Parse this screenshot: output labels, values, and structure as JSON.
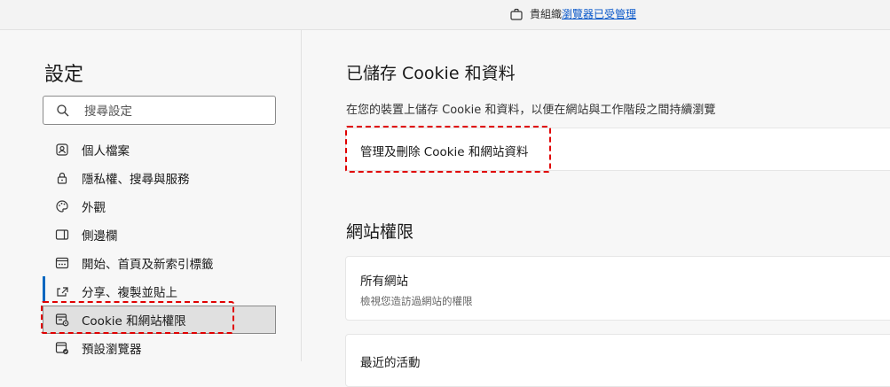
{
  "banner": {
    "prefix": "貴組織",
    "link": "瀏覽器已受管理"
  },
  "sidebar": {
    "title": "設定",
    "search_placeholder": "搜尋設定",
    "items": [
      {
        "label": "個人檔案",
        "icon": "profile-icon"
      },
      {
        "label": "隱私權、搜尋與服務",
        "icon": "lock-icon"
      },
      {
        "label": "外觀",
        "icon": "palette-icon"
      },
      {
        "label": "側邊欄",
        "icon": "sidebar-icon"
      },
      {
        "label": "開始、首頁及新索引標籤",
        "icon": "new-tab-icon"
      },
      {
        "label": "分享、複製並貼上",
        "icon": "share-icon"
      },
      {
        "label": "Cookie 和網站權限",
        "icon": "site-permissions-icon",
        "active": true
      },
      {
        "label": "預設瀏覽器",
        "icon": "default-browser-icon"
      }
    ]
  },
  "main": {
    "cookies": {
      "heading": "已儲存 Cookie 和資料",
      "description": "在您的裝置上儲存 Cookie 和資料，以便在網站與工作階段之間持續瀏覽",
      "manage_label": "管理及刪除 Cookie 和網站資料"
    },
    "permissions": {
      "heading": "網站權限",
      "all_sites_title": "所有網站",
      "all_sites_sub": "檢視您造訪過網站的權限",
      "recent_title": "最近的活動"
    }
  },
  "colors": {
    "accent": "#0067c0",
    "highlight_dash": "#e00000",
    "link": "#0a58ca"
  }
}
